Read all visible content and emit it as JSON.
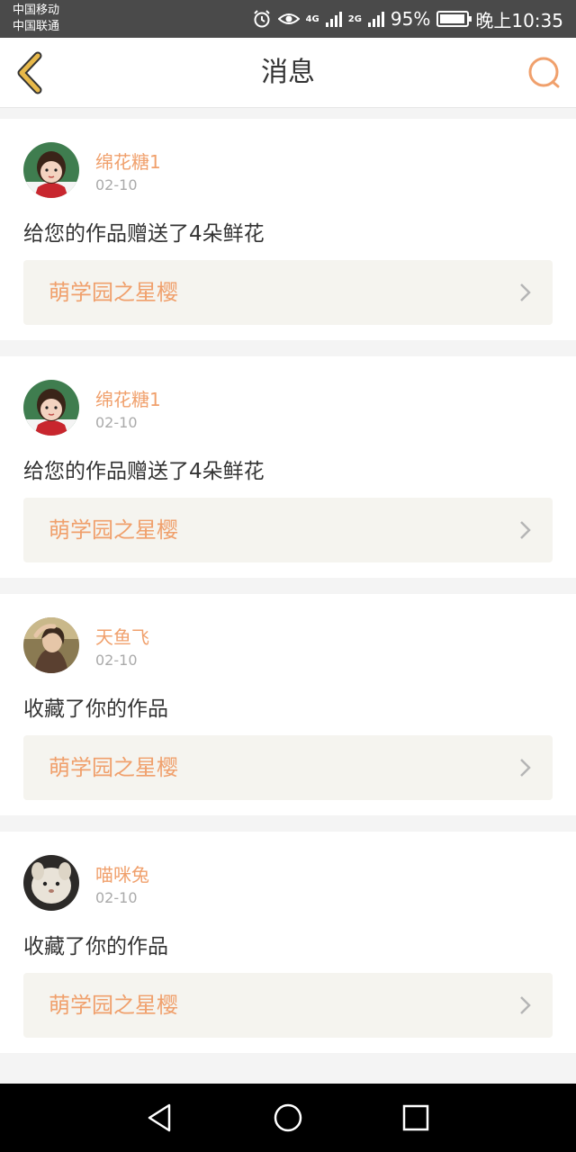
{
  "status": {
    "carrier1": "中国移动",
    "carrier2": "中国联通",
    "net1": "4G",
    "net2": "2G",
    "battery_percent": "95%",
    "battery_level": 0.95,
    "time": "晚上10:35",
    "icons": [
      "alarm-icon",
      "eye-icon",
      "signal-icon",
      "battery-icon"
    ]
  },
  "header": {
    "title": "消息",
    "back_icon": "chevron-left-icon",
    "search_icon": "search-icon",
    "accent_color": "#f0a06c",
    "back_color": "#e8b94a"
  },
  "messages": [
    {
      "username": "绵花糖1",
      "time": "02-10",
      "action": "给您的作品赠送了4朵鲜花",
      "work": "萌学园之星樱",
      "avatar": "girl"
    },
    {
      "username": "绵花糖1",
      "time": "02-10",
      "action": "给您的作品赠送了4朵鲜花",
      "work": "萌学园之星樱",
      "avatar": "girl"
    },
    {
      "username": "天鱼飞",
      "time": "02-10",
      "action": "收藏了你的作品",
      "work": "萌学园之星樱",
      "avatar": "woman"
    },
    {
      "username": "喵咪兔",
      "time": "02-10",
      "action": "收藏了你的作品",
      "work": "萌学园之星樱",
      "avatar": "bunny"
    }
  ],
  "navbar": {
    "icons": [
      "back-triangle-icon",
      "home-circle-icon",
      "recents-square-icon"
    ]
  }
}
